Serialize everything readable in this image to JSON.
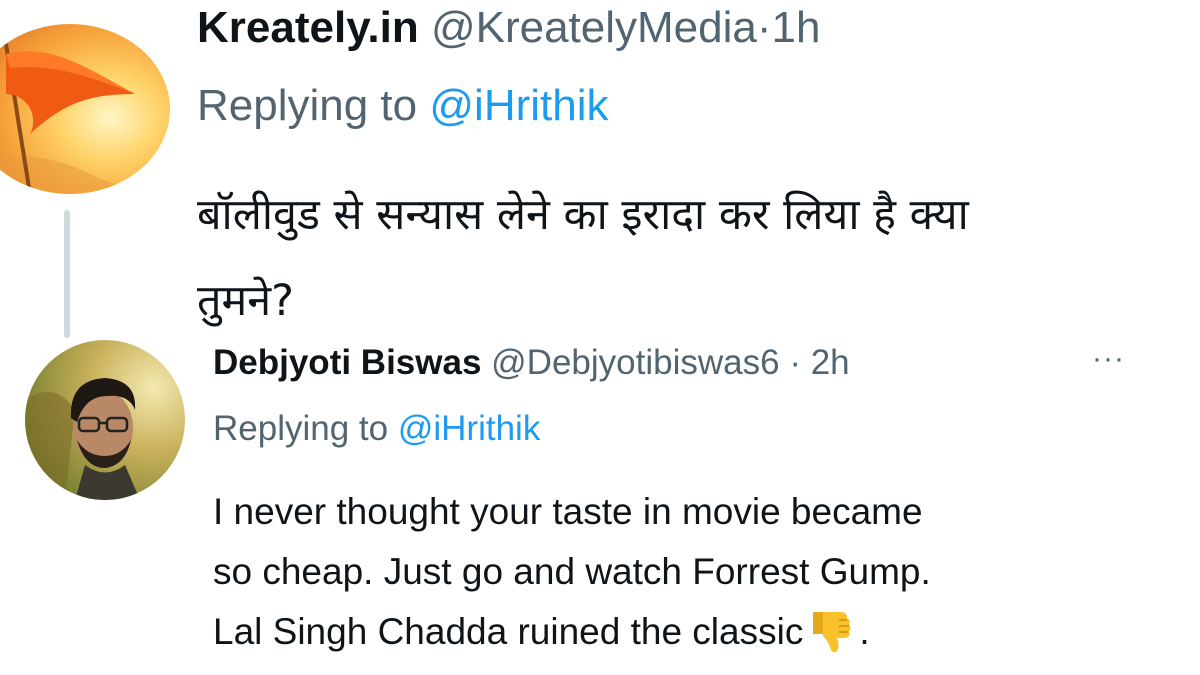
{
  "tweets": [
    {
      "display_name": "Kreately.in",
      "handle": "@KreatelyMedia",
      "separator": "·",
      "time": "1h",
      "replying_prefix": "Replying to",
      "replying_to": "@iHrithik",
      "text_line1": "बॉलीवुड से सन्यास लेने का इरादा कर लिया है क्या",
      "text_line2": "तुमने?",
      "avatar_icon": "saffron-flag-avatar"
    },
    {
      "display_name": "Debjyoti Biswas",
      "handle": "@Debjyotibiswas6",
      "separator": "·",
      "time": "2h",
      "more_label": "···",
      "replying_prefix": "Replying to",
      "replying_to": "@iHrithik",
      "text_line1": "I never thought your taste in movie became",
      "text_line2": "so cheap. Just go and watch Forrest Gump.",
      "text_line3_before": "Lal Singh Chadda ruined the classic",
      "emoji": "thumbs-down",
      "text_line3_after": ".",
      "avatar_icon": "profile-photo-avatar"
    }
  ],
  "colors": {
    "text": "#0f1419",
    "secondary": "#536471",
    "link": "#1d9bf0",
    "thread_line": "#cfd9de",
    "emoji": "#f7c22a"
  }
}
